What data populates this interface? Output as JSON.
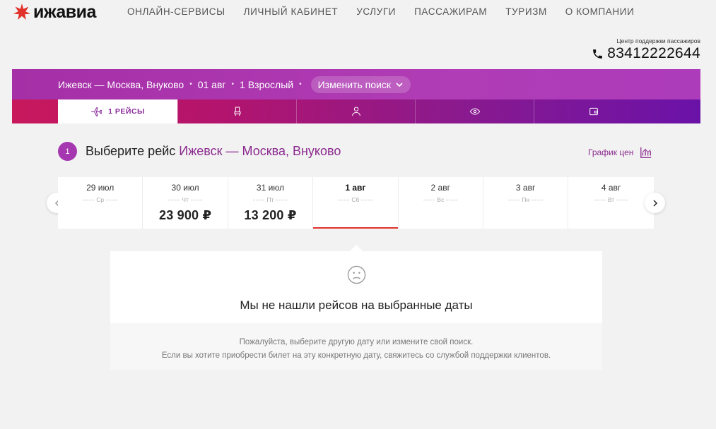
{
  "brand": {
    "logo_text": "ижавиа",
    "accent": "#e1312b"
  },
  "nav": [
    "ОНЛАЙН-СЕРВИСЫ",
    "ЛИЧНЫЙ КАБИНЕТ",
    "УСЛУГИ",
    "ПАССАЖИРАМ",
    "ТУРИЗМ",
    "О КОМПАНИИ"
  ],
  "support": {
    "label": "Центр поддержки пассажиров",
    "phone": "83412222644"
  },
  "search": {
    "route": "Ижевск — Москва, Внуково",
    "date": "01 авг",
    "passengers": "1 Взрослый",
    "change_label": "Изменить поиск"
  },
  "steps": {
    "active_label": "1 РЕЙСЫ",
    "icons": [
      "seat-icon",
      "passenger-icon",
      "eye-icon",
      "wallet-icon"
    ]
  },
  "title": {
    "step_number": "1",
    "prefix": "Выберите рейс",
    "route": "Ижевск — Москва, Внуково"
  },
  "price_chart_label": "График цен",
  "dates": [
    {
      "date": "29 июл",
      "weekday": "Ср",
      "price": ""
    },
    {
      "date": "30 июл",
      "weekday": "Чт",
      "price": "23 900 ₽"
    },
    {
      "date": "31 июл",
      "weekday": "Пт",
      "price": "13 200 ₽"
    },
    {
      "date": "1 авг",
      "weekday": "Сб",
      "price": "",
      "active": true
    },
    {
      "date": "2 авг",
      "weekday": "Вс",
      "price": ""
    },
    {
      "date": "3 авг",
      "weekday": "Пн",
      "price": ""
    },
    {
      "date": "4 авг",
      "weekday": "Вт",
      "price": ""
    }
  ],
  "empty": {
    "title": "Мы не нашли рейсов на выбранные даты",
    "line1": "Пожалуйста, выберите другую дату или измените свой поиск.",
    "line2": "Если вы хотите приобрести билет на эту конкретную дату, свяжитесь со службой поддержки клиентов."
  }
}
